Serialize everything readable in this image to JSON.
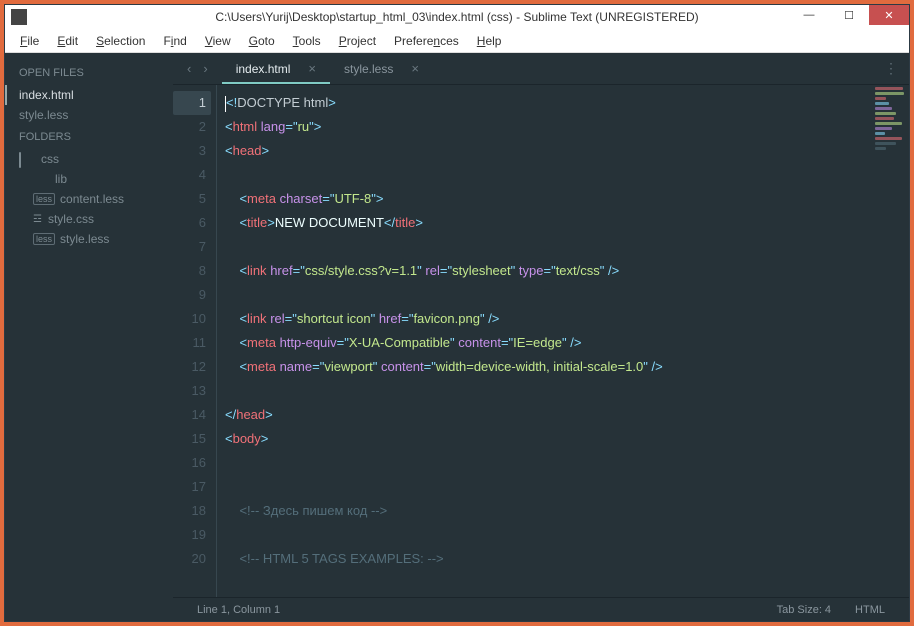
{
  "titlebar": {
    "title": "C:\\Users\\Yurij\\Desktop\\startup_html_03\\index.html (css) - Sublime Text (UNREGISTERED)"
  },
  "menu": {
    "file": "File",
    "edit": "Edit",
    "selection": "Selection",
    "find": "Find",
    "view": "View",
    "goto": "Goto",
    "tools": "Tools",
    "project": "Project",
    "preferences": "Preferences",
    "help": "Help"
  },
  "sidebar": {
    "open_files_heading": "OPEN FILES",
    "open_files": [
      {
        "label": "index.html",
        "active": true
      },
      {
        "label": "style.less",
        "active": false
      }
    ],
    "folders_heading": "FOLDERS",
    "root": "css",
    "items": [
      {
        "label": "lib",
        "type": "folder"
      },
      {
        "label": "content.less",
        "type": "less"
      },
      {
        "label": "style.css",
        "type": "css"
      },
      {
        "label": "style.less",
        "type": "less"
      }
    ]
  },
  "tabs": [
    {
      "label": "index.html",
      "active": true
    },
    {
      "label": "style.less",
      "active": false
    }
  ],
  "code": {
    "lines": [
      {
        "n": 1,
        "html": "<span class='punct'>&lt;!</span><span class='doctype'>DOCTYPE html</span><span class='punct'>&gt;</span>",
        "current": true
      },
      {
        "n": 2,
        "html": "<span class='punct'>&lt;</span><span class='tagn'>html</span> <span class='attr'>lang</span><span class='eq'>=</span><span class='punct'>\"</span><span class='str'>ru</span><span class='punct'>\"</span><span class='punct'>&gt;</span>"
      },
      {
        "n": 3,
        "html": "<span class='punct'>&lt;</span><span class='tagn'>head</span><span class='punct'>&gt;</span>"
      },
      {
        "n": 4,
        "html": ""
      },
      {
        "n": 5,
        "html": "    <span class='punct'>&lt;</span><span class='tagn'>meta</span> <span class='attr'>charset</span><span class='eq'>=</span><span class='punct'>\"</span><span class='str'>UTF-8</span><span class='punct'>\"</span><span class='punct'>&gt;</span>"
      },
      {
        "n": 6,
        "html": "    <span class='punct'>&lt;</span><span class='tagn'>title</span><span class='punct'>&gt;</span><span class='txt'>NEW DOCUMENT</span><span class='punct'>&lt;/</span><span class='tagn'>title</span><span class='punct'>&gt;</span>"
      },
      {
        "n": 7,
        "html": ""
      },
      {
        "n": 8,
        "html": "    <span class='punct'>&lt;</span><span class='tagn'>link</span> <span class='attr'>href</span><span class='eq'>=</span><span class='punct'>\"</span><span class='str'>css/style.css?v=1.1</span><span class='punct'>\"</span> <span class='attr'>rel</span><span class='eq'>=</span><span class='punct'>\"</span><span class='str'>stylesheet</span><span class='punct'>\"</span> <span class='attr'>type</span><span class='eq'>=</span><span class='punct'>\"</span><span class='str'>text/css</span><span class='punct'>\"</span> <span class='punct'>/&gt;</span>"
      },
      {
        "n": 9,
        "html": ""
      },
      {
        "n": 10,
        "html": "    <span class='punct'>&lt;</span><span class='tagn'>link</span> <span class='attr'>rel</span><span class='eq'>=</span><span class='punct'>\"</span><span class='str'>shortcut icon</span><span class='punct'>\"</span> <span class='attr'>href</span><span class='eq'>=</span><span class='punct'>\"</span><span class='str'>favicon.png</span><span class='punct'>\"</span> <span class='punct'>/&gt;</span>"
      },
      {
        "n": 11,
        "html": "    <span class='punct'>&lt;</span><span class='tagn'>meta</span> <span class='attr'>http-equiv</span><span class='eq'>=</span><span class='punct'>\"</span><span class='str'>X-UA-Compatible</span><span class='punct'>\"</span> <span class='attr'>content</span><span class='eq'>=</span><span class='punct'>\"</span><span class='str'>IE=edge</span><span class='punct'>\"</span> <span class='punct'>/&gt;</span>"
      },
      {
        "n": 12,
        "html": "    <span class='punct'>&lt;</span><span class='tagn'>meta</span> <span class='attr'>name</span><span class='eq'>=</span><span class='punct'>\"</span><span class='str'>viewport</span><span class='punct'>\"</span> <span class='attr'>content</span><span class='eq'>=</span><span class='punct'>\"</span><span class='str'>width=device-width, initial-scale=1.0</span><span class='punct'>\"</span> <span class='punct'>/&gt;</span>"
      },
      {
        "n": 13,
        "html": ""
      },
      {
        "n": 14,
        "html": "<span class='punct'>&lt;/</span><span class='tagn'>head</span><span class='punct'>&gt;</span>"
      },
      {
        "n": 15,
        "html": "<span class='punct'>&lt;</span><span class='tagn'>body</span><span class='punct'>&gt;</span>"
      },
      {
        "n": 16,
        "html": ""
      },
      {
        "n": 17,
        "html": ""
      },
      {
        "n": 18,
        "html": "    <span class='cmt'>&lt;!-- Здесь пишем код --&gt;</span>"
      },
      {
        "n": 19,
        "html": ""
      },
      {
        "n": 20,
        "html": "    <span class='cmt'>&lt;!-- HTML 5 TAGS EXAMPLES: --&gt;</span>"
      }
    ]
  },
  "status": {
    "position": "Line 1, Column 1",
    "tabsize": "Tab Size: 4",
    "syntax": "HTML"
  },
  "minimap_colors": [
    "#f07178",
    "#c3e88d",
    "#f07178",
    "#89ddff",
    "#c792ea",
    "#c3e88d",
    "#f07178",
    "#c3e88d",
    "#c792ea",
    "#89ddff",
    "#f07178",
    "#546e7a",
    "#546e7a"
  ]
}
